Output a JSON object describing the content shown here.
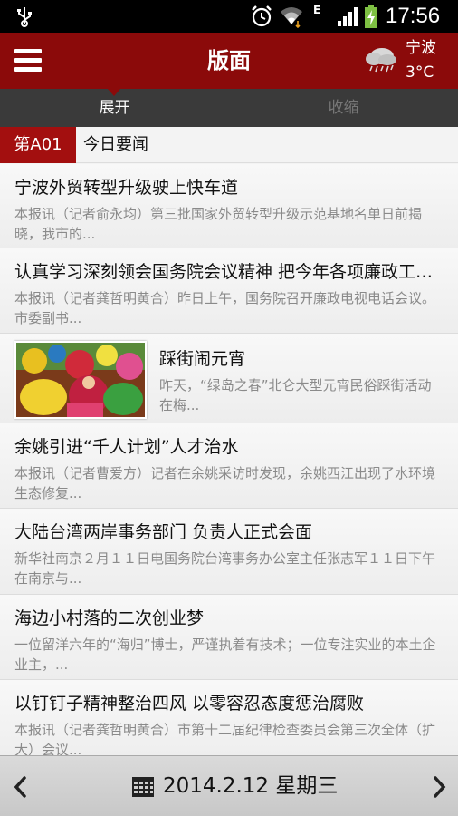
{
  "status_bar": {
    "time": "17:56",
    "network_type": "E",
    "icons": [
      "usb-icon",
      "alarm-icon",
      "wifi-icon",
      "signal-icon",
      "battery-charging-icon"
    ]
  },
  "app_bar": {
    "title": "版面",
    "weather": {
      "city": "宁波",
      "temperature": "3°C",
      "icon": "rain-cloud-icon"
    }
  },
  "tabs": [
    {
      "label": "展开",
      "active": true
    },
    {
      "label": "收缩",
      "active": false
    }
  ],
  "section": {
    "badge": "第A01",
    "title": "今日要闻"
  },
  "articles": [
    {
      "title": "宁波外贸转型升级驶上快车道",
      "summary": "本报讯（记者俞永均）第三批国家外贸转型升级示范基地名单日前揭晓，我市的..."
    },
    {
      "title": "认真学习深刻领会国务院会议精神 把今年各项廉政工作落到实处",
      "summary": "本报讯（记者龚哲明黄合）昨日上午，国务院召开廉政电视电话会议。市委副书..."
    },
    {
      "title": "踩街闹元宵",
      "summary": "昨天，“绿岛之春”北仑大型元宵民俗踩街活动在梅...",
      "has_image": true
    },
    {
      "title": "余姚引进“千人计划”人才治水",
      "summary": "本报讯（记者曹爱方）记者在余姚采访时发现，余姚西江出现了水环境生态修复..."
    },
    {
      "title": "大陆台湾两岸事务部门 负责人正式会面",
      "summary": "新华社南京２月１１日电国务院台湾事务办公室主任张志军１１日下午在南京与..."
    },
    {
      "title": "海边小村落的二次创业梦",
      "summary": "一位留洋六年的“海归”博士，严谨执着有技术；一位专注实业的本土企业主，..."
    },
    {
      "title": "以钉钉子精神整治四风 以零容忍态度惩治腐败",
      "summary": "本报讯（记者龚哲明黄合）市第十二届纪律检查委员会第三次全体（扩大）会议..."
    }
  ],
  "bottom_bar": {
    "date": "2014.2.12 星期三"
  },
  "colors": {
    "brand_red": "#8b0a0a",
    "badge_red": "#a30f0f",
    "tab_bar": "#3a3a3a"
  }
}
